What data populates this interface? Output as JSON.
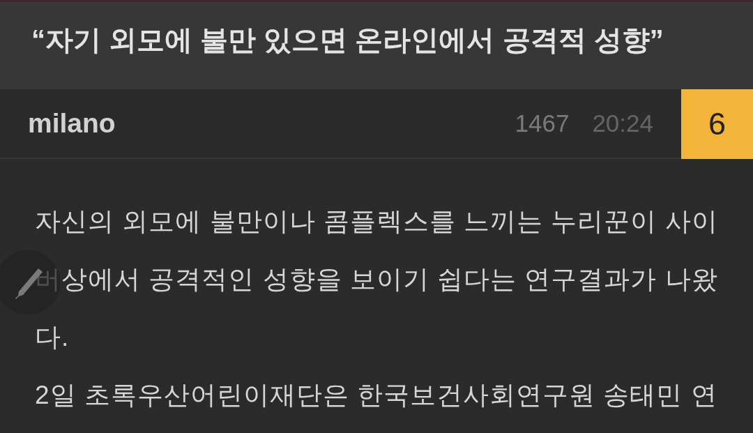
{
  "article": {
    "title": "“자기 외모에 불만 있으면 온라인에서 공격적 성향”"
  },
  "post_info": {
    "author": "milano",
    "views": "1467",
    "time": "20:24",
    "comments": "6"
  },
  "body": {
    "paragraphs": [
      "자신의 외모에 불만이나 콤플렉스를 느끼는 누리꾼이 사이버상에서 공격적인 성향을 보이기 쉽다는 연구결과가 나왔다.",
      "2일 초록우산어린이재단은 한국보건사회연구원 송태민 연"
    ]
  }
}
